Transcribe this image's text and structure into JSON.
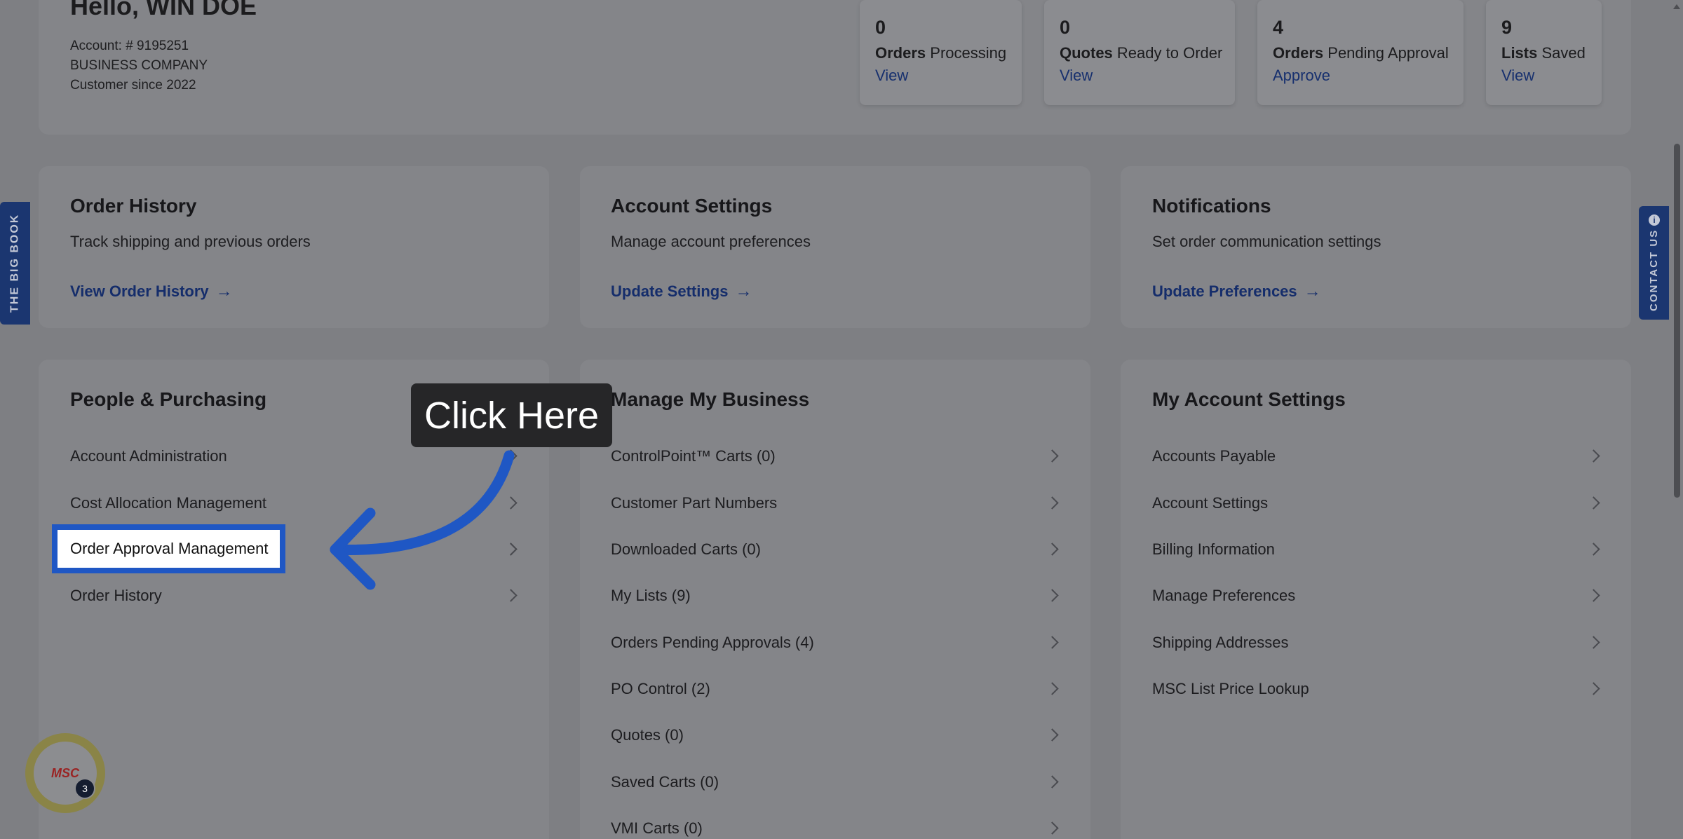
{
  "header": {
    "greeting": "Hello, WIN DOE",
    "account": "Account: # 9195251",
    "company": "BUSINESS COMPANY",
    "since": "Customer since 2022"
  },
  "stats": [
    {
      "num": "0",
      "bold": "Orders",
      "rest": " Processing",
      "link": "View"
    },
    {
      "num": "0",
      "bold": "Quotes",
      "rest": " Ready to Order",
      "link": "View"
    },
    {
      "num": "4",
      "bold": "Orders",
      "rest": " Pending Approval",
      "link": "Approve"
    },
    {
      "num": "9",
      "bold": "Lists",
      "rest": " Saved",
      "link": "View"
    }
  ],
  "top_cards": [
    {
      "title": "Order History",
      "sub": "Track shipping and previous orders",
      "link": "View Order History"
    },
    {
      "title": "Account Settings",
      "sub": "Manage account preferences",
      "link": "Update Settings"
    },
    {
      "title": "Notifications",
      "sub": "Set order communication settings",
      "link": "Update Preferences"
    }
  ],
  "people": {
    "title": "People & Purchasing",
    "items": [
      "Account Administration",
      "Cost Allocation Management",
      "Order Approval Management",
      "Order History"
    ]
  },
  "business": {
    "title": "Manage My Business",
    "items": [
      "ControlPoint™ Carts (0)",
      "Customer Part Numbers",
      "Downloaded Carts (0)",
      "My Lists (9)",
      "Orders Pending Approvals (4)",
      "PO Control (2)",
      "Quotes (0)",
      "Saved Carts (0)",
      "VMI Carts (0)"
    ]
  },
  "my_account": {
    "title": "My Account Settings",
    "items": [
      "Accounts Payable",
      "Account Settings",
      "Billing Information",
      "Manage Preferences",
      "Shipping Addresses",
      "MSC List Price Lookup"
    ]
  },
  "side_tabs": {
    "left": "THE BIG BOOK",
    "right": "CONTACT US"
  },
  "callout": "Click Here",
  "chat": {
    "logo": "MSC",
    "count": "3"
  },
  "colors": {
    "accent": "#1f57c4",
    "link": "#152d6b",
    "tab": "#1b3670"
  }
}
